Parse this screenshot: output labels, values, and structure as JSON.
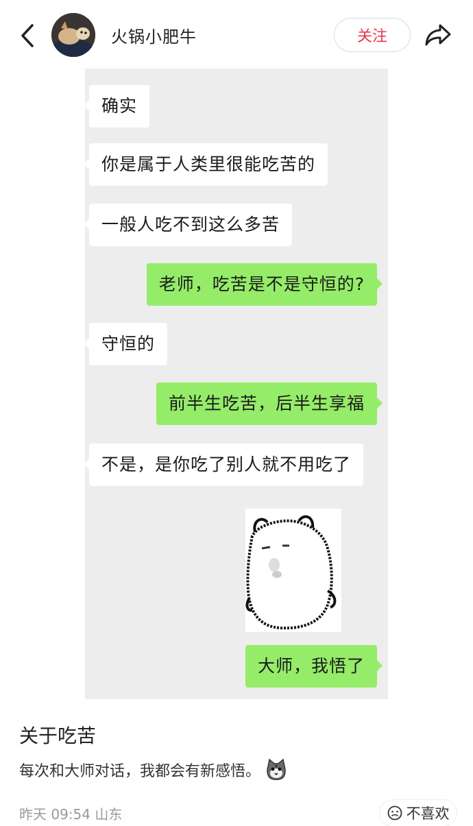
{
  "header": {
    "author_name": "火锅小肥牛",
    "follow_label": "关注",
    "icons": {
      "back": "chevron-left-icon",
      "share": "share-arrow-icon",
      "avatar": "avatar"
    },
    "accent_color": "#e8364e"
  },
  "chat": {
    "colors": {
      "background": "#ededed",
      "left_bubble": "#ffffff",
      "right_bubble": "#95ec69"
    },
    "messages": [
      {
        "side": "left",
        "text": "确实"
      },
      {
        "side": "left",
        "text": "你是属于人类里很能吃苦的"
      },
      {
        "side": "left",
        "text": "一般人吃不到这么多苦"
      },
      {
        "side": "right",
        "text": "老师，吃苦是不是守恒的?"
      },
      {
        "side": "left",
        "text": "守恒的"
      },
      {
        "side": "right",
        "text": "前半生吃苦，后半生享福"
      },
      {
        "side": "left",
        "text": "不是，是你吃了别人就不用吃了"
      },
      {
        "side": "left",
        "text": "",
        "type": "sticker",
        "icon": "bear-sticker-icon"
      },
      {
        "side": "right",
        "text": "大师，我悟了"
      }
    ]
  },
  "post": {
    "title": "关于吃苦",
    "body": "每次和大师对话，我都会有新感悟。",
    "body_emoji": "cat-face-icon"
  },
  "footer": {
    "meta": "昨天 09:54 山东",
    "dislike_label": "不喜欢",
    "dislike_icon": "frown-face-icon"
  }
}
